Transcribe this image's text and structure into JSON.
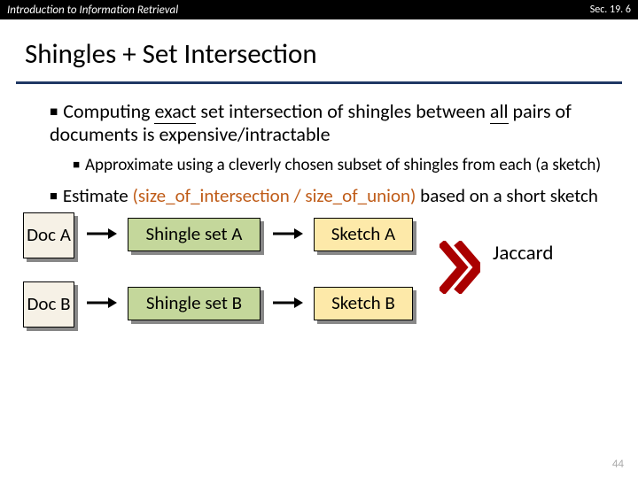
{
  "header": {
    "left": "Introduction to Information Retrieval",
    "right": "Sec. 19. 6"
  },
  "title": "Shingles + Set Intersection",
  "bullets": {
    "b1_pre": "Computing ",
    "b1_u1": "exact",
    "b1_mid": " set intersection of shingles between ",
    "b1_u2": "all",
    "b1_post": " pairs of documents is expensive/intractable",
    "b2": "Approximate using a cleverly chosen subset of shingles from each (a sketch)",
    "b3_pre": "Estimate ",
    "b3_orange": "(size_of_intersection / size_of_union)",
    "b3_post": " based on a short sketch"
  },
  "diagram": {
    "docA": "Doc A",
    "docB": "Doc B",
    "shingleA": "Shingle set A",
    "shingleB": "Shingle set B",
    "sketchA": "Sketch A",
    "sketchB": "Sketch B",
    "jaccard": "Jaccard"
  },
  "pagenum": "44"
}
